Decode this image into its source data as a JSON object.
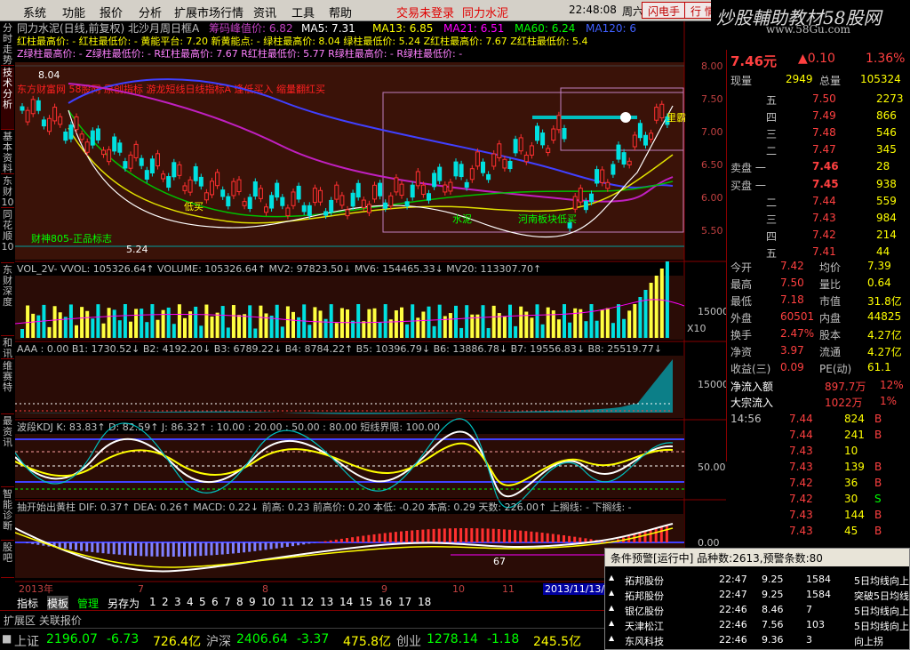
{
  "menu": {
    "items": [
      "系统",
      "功能",
      "报价",
      "分析",
      "扩展市场行情",
      "资讯",
      "工具",
      "帮助"
    ],
    "trade_status": "交易未登录",
    "stock_title": "同力水泥",
    "time": "22:48:08",
    "weekday": "周六",
    "flash_btn": "闪电手",
    "quote_btn": "行 情"
  },
  "brand": {
    "title": "炒股輔助教材58股网",
    "url": "www.58Gu.com"
  },
  "left_tabs": [
    "分时走势",
    "技术分析",
    "基本资料",
    "东财10",
    "同花顺10",
    "东财深度",
    "和讯",
    "维赛特",
    "最资讯",
    "智能诊断",
    "股吧"
  ],
  "main_panel": {
    "header": "同力水泥(日线,前复权) 北沙月周日框A",
    "chips": {
      "label": "筹码峰值价: 6.82"
    },
    "ma": [
      {
        "label": "MA5:",
        "value": "7.31",
        "color": "#ffffff"
      },
      {
        "label": "MA13:",
        "value": "6.85",
        "color": "#ffff00"
      },
      {
        "label": "MA21:",
        "value": "6.51",
        "color": "#ff00ff"
      },
      {
        "label": "MA60:",
        "value": "6.24",
        "color": "#00ff00"
      },
      {
        "label": "MA120:",
        "value": "6",
        "color": "#4060ff"
      }
    ],
    "line2": "红柱最高价: - 红柱最低价: -   黄能平台: 7.20  新黄能点: -    绿柱最高价: 8.04 绿柱最低价: 5.24    Z红柱最高价: 7.67 Z红柱最低价: 5.4",
    "line3": "Z绿柱最高价: - Z绿柱最低价: -   R红柱最高价: 7.67 R红柱最低价: 5.77    R绿柱最高价: - R绿柱最低价: -",
    "annotation": "东方财富网 58股网 原创指标 游龙短线日线指标A 逢低买入 缩量翻红买",
    "yaxis": [
      "8.00",
      "7.50",
      "7.00",
      "6.50",
      "6.00",
      "5.50"
    ],
    "labels": {
      "hi": "8.04",
      "lo": "5.24",
      "logo": "财神805-正品标志",
      "shuini": "水泥",
      "henan": "河南板块低买",
      "buy": "低买",
      "cur": "里霸"
    }
  },
  "vol_panel": {
    "header": "VOL_2V-  VVOL: 105326.64↑ VOLUME: 105326.64↑   MV2: 97823.50↓  MV6: 154465.33↓  MV20: 113307.70↑",
    "axis": "15000",
    "x10": "X10"
  },
  "aaa_panel": {
    "header": "AAA   : 0.00  B1: 1730.52↓  B2: 4192.20↓  B3: 6789.22↓  B4: 8784.22↑  B5: 10396.79↓  B6: 13886.78↓  B7: 19556.83↓  B8: 25519.77↓",
    "axis": "15000"
  },
  "kdj_panel": {
    "header": "波段KDJ   K: 83.83↑  D: 82.59↑  J: 86.32↑  : 10.00  : 20.00 : 50.00 : 80.00   短线界限: 100.00",
    "axis": "50.00"
  },
  "macd_panel": {
    "header": "抽开始出黄柱  DIF: 0.37↑  DEA: 0.26↑  MACD: 0.22↓   前高: 0.23  前高价: 0.20  本低: -0.20  本高: 0.29  天数: 226.00↑  上搁线: -  下搁线: -",
    "axis": "0.00",
    "num": "67"
  },
  "xaxis": [
    "2013年",
    "7",
    "8",
    "9",
    "10",
    "11",
    "2013/11/13/三"
  ],
  "bottom_tabs": [
    "指标",
    "模板",
    "管理",
    "另存为",
    "1",
    "2",
    "3",
    "4",
    "5",
    "6",
    "7",
    "8",
    "9",
    "10",
    "11",
    "12",
    "13",
    "14",
    "15",
    "16",
    "17",
    "18"
  ],
  "ext_bar": "扩展区  关联报价",
  "quote": {
    "price": "7.46元",
    "change": "▲0.10",
    "pct": "1.36%",
    "xianliang": {
      "label": "现量",
      "value": "2949"
    },
    "zongliang": {
      "label": "总量",
      "value": "105324"
    },
    "sells": [
      {
        "l": "五",
        "p": "7.50",
        "v": "2273"
      },
      {
        "l": "四",
        "p": "7.49",
        "v": "866"
      },
      {
        "l": "三",
        "p": "7.48",
        "v": "546"
      },
      {
        "l": "二",
        "p": "7.47",
        "v": "345"
      },
      {
        "l": "卖盘 一",
        "p": "7.46",
        "v": "28"
      }
    ],
    "buys": [
      {
        "l": "买盘 一",
        "p": "7.45",
        "v": "938"
      },
      {
        "l": "二",
        "p": "7.44",
        "v": "559"
      },
      {
        "l": "三",
        "p": "7.43",
        "v": "984"
      },
      {
        "l": "四",
        "p": "7.42",
        "v": "214"
      },
      {
        "l": "五",
        "p": "7.41",
        "v": "44"
      }
    ],
    "stats": [
      [
        "今开",
        "7.42",
        "均价",
        "7.39"
      ],
      [
        "最高",
        "7.50",
        "量比",
        "0.64"
      ],
      [
        "最低",
        "7.18",
        "市值",
        "31.8亿"
      ],
      [
        "外盘",
        "60501",
        "内盘",
        "44825"
      ],
      [
        "换手",
        "2.47%",
        "股本",
        "4.27亿"
      ],
      [
        "净资",
        "3.97",
        "流通",
        "4.27亿"
      ],
      [
        "收益(三)",
        "0.09",
        "PE(动)",
        "61.1"
      ]
    ],
    "flows": [
      [
        "净流入额",
        "897.7万",
        "12%"
      ],
      [
        "大宗流入",
        "1022万",
        "1%"
      ]
    ],
    "ticks": [
      [
        "14:56",
        "7.44",
        "824",
        "B"
      ],
      [
        "",
        "7.44",
        "241",
        "B"
      ],
      [
        "",
        "7.43",
        "10",
        ""
      ],
      [
        "",
        "7.43",
        "139",
        "B"
      ],
      [
        "",
        "7.42",
        "36",
        "B"
      ],
      [
        "",
        "7.42",
        "30",
        "S"
      ],
      [
        "",
        "7.43",
        "144",
        "B"
      ],
      [
        "",
        "7.43",
        "45",
        "B"
      ]
    ]
  },
  "alert": {
    "title": "条件预警[运行中] 品种数:2613,预警条数:80",
    "rows": [
      [
        "拓邦股份",
        "22:47",
        "9.25",
        "1584",
        "5日均线向上"
      ],
      [
        "拓邦股份",
        "22:47",
        "9.25",
        "1584",
        "突破5日均线"
      ],
      [
        "银亿股份",
        "22:46",
        "8.46",
        "7",
        "5日均线向上"
      ],
      [
        "天津松江",
        "22:46",
        "7.56",
        "103",
        "5日均线向上"
      ],
      [
        "东风科技",
        "22:46",
        "9.36",
        "3",
        "向上拐"
      ]
    ]
  },
  "status": {
    "sh_label": "上证",
    "sh": "2196.07",
    "sh_chg": "-6.73",
    "sh_amt": "726.4亿",
    "sz_label": "沪深",
    "sz": "2406.64",
    "sz_chg": "-3.37",
    "sz_amt": "475.8亿",
    "cy_label": "创业",
    "cy": "1278.14",
    "cy_chg": "-1.18",
    "cy_amt": "245.5亿"
  }
}
